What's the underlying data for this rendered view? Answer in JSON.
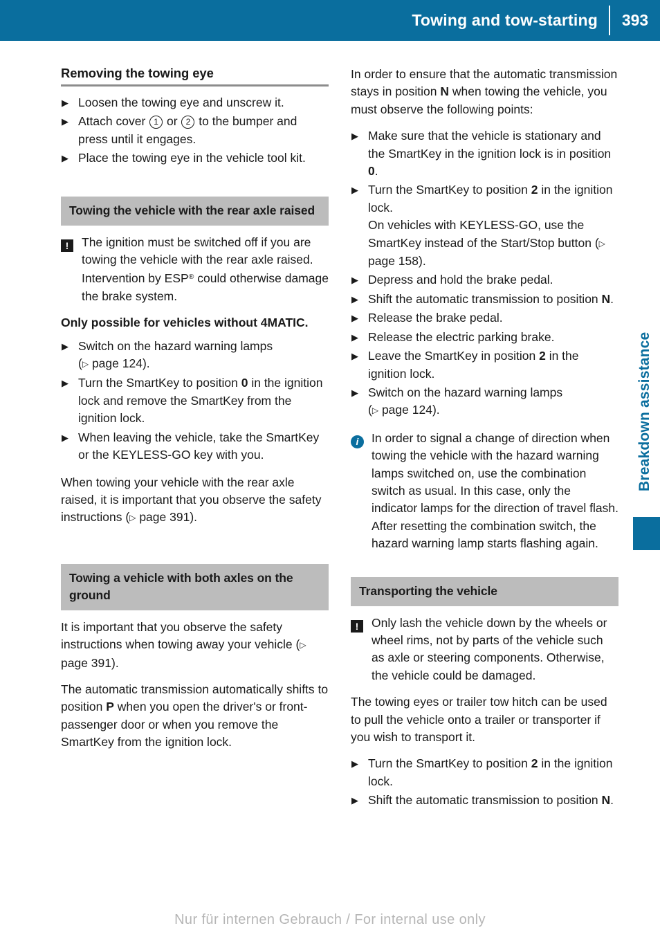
{
  "header": {
    "title": "Towing and tow-starting",
    "page_number": "393",
    "bar_color": "#0a6e9e"
  },
  "side": {
    "chapter_label": "Breakdown assistance",
    "tab_color": "#0a6e9e"
  },
  "footer": {
    "watermark": "Nur für internen Gebrauch / For internal use only"
  },
  "left_column": {
    "section1": {
      "heading": "Removing the towing eye",
      "bullets": [
        {
          "text": "Loosen the towing eye and unscrew it."
        },
        {
          "pre": "Attach cover ",
          "circ1": "1",
          "mid": " or ",
          "circ2": "2",
          "post": " to the bumper and press until it engages."
        },
        {
          "text": "Place the towing eye in the vehicle tool kit."
        }
      ]
    },
    "section2": {
      "heading": "Towing the vehicle with the rear axle raised",
      "warning": {
        "icon": "warning-icon",
        "text_a": "The ignition must be switched off if you are towing the vehicle with the rear axle raised. Intervention by ESP",
        "reg": "®",
        "text_b": " could otherwise damage the brake system."
      },
      "bold_note": "Only possible for vehicles without 4MATIC.",
      "bullets": [
        {
          "text": "Switch on the hazard warning lamps",
          "ref": "page 124"
        },
        {
          "text": "Turn the SmartKey to position ",
          "bold": "0",
          "tail": " in the ignition lock and remove the SmartKey from the ignition lock."
        },
        {
          "text": "When leaving the vehicle, take the SmartKey or the KEYLESS-GO key with you."
        }
      ],
      "closing_a": "When towing your vehicle with the rear axle raised, it is important that you observe the safety instructions ",
      "closing_ref": "page 391",
      "closing_b": "."
    },
    "section3": {
      "heading": "Towing a vehicle with both axles on the ground",
      "para1_a": "It is important that you observe the safety instructions when towing away your vehicle ",
      "para1_ref": "page 391",
      "para1_b": ".",
      "para2_a": "The automatic transmission automatically shifts to position ",
      "para2_bold": "P",
      "para2_b": " when you open the driver's or front-passenger door or when you remove the SmartKey from the ignition lock."
    }
  },
  "right_column": {
    "intro_a": "In order to ensure that the automatic transmission stays in position ",
    "intro_bold": "N",
    "intro_b": " when towing the vehicle, you must observe the following points:",
    "bullets": [
      {
        "a": "Make sure that the vehicle is stationary and the SmartKey in the ignition lock is in position ",
        "bold": "0",
        "b": "."
      },
      {
        "a": "Turn the SmartKey to position ",
        "bold": "2",
        "b": " in the ignition lock.",
        "sub_a": "On vehicles with KEYLESS-GO, use the SmartKey instead of the Start/Stop button ",
        "sub_ref": "page 158",
        "sub_b": "."
      },
      {
        "a": "Depress and hold the brake pedal."
      },
      {
        "a": "Shift the automatic transmission to position ",
        "bold": "N",
        "b": "."
      },
      {
        "a": "Release the brake pedal."
      },
      {
        "a": "Release the electric parking brake."
      },
      {
        "a": "Leave the SmartKey in position ",
        "bold": "2",
        "b": " in the ignition lock."
      },
      {
        "a": "Switch on the hazard warning lamps ",
        "ref": "page 124",
        "b": "."
      }
    ],
    "info": {
      "icon": "info-icon",
      "text": "In order to signal a change of direction when towing the vehicle with the hazard warning lamps switched on, use the combination switch as usual. In this case, only the indicator lamps for the direction of travel flash. After resetting the combination switch, the hazard warning lamp starts flashing again."
    },
    "section_transport": {
      "heading": "Transporting the vehicle",
      "warning": {
        "icon": "warning-icon",
        "text": "Only lash the vehicle down by the wheels or wheel rims, not by parts of the vehicle such as axle or steering components. Otherwise, the vehicle could be damaged."
      },
      "para": "The towing eyes or trailer tow hitch can be used to pull the vehicle onto a trailer or transporter if you wish to transport it.",
      "bullets": [
        {
          "a": "Turn the SmartKey to position ",
          "bold": "2",
          "b": " in the ignition lock."
        },
        {
          "a": "Shift the automatic transmission to position ",
          "bold": "N",
          "b": "."
        }
      ]
    }
  },
  "glyphs": {
    "bullet_triangle": "▶",
    "page_triangle": "▷",
    "warning_mark": "!",
    "info_mark": "i"
  }
}
